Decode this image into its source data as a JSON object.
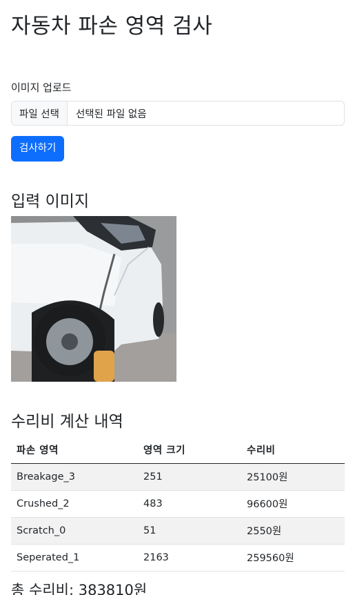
{
  "page": {
    "title": "자동차 파손 영역 검사"
  },
  "upload": {
    "label": "이미지 업로드",
    "file_button": "파일 선택",
    "file_status": "선택된 파일 없음",
    "submit_label": "검사하기"
  },
  "input_section": {
    "title": "입력 이미지"
  },
  "cost_section": {
    "title": "수리비 계산 내역",
    "headers": [
      "파손 영역",
      "영역 크기",
      "수리비"
    ],
    "rows": [
      [
        "Breakage_3",
        "251",
        "25100원"
      ],
      [
        "Crushed_2",
        "483",
        "96600원"
      ],
      [
        "Scratch_0",
        "51",
        "2550원"
      ],
      [
        "Seperated_1",
        "2163",
        "259560원"
      ]
    ],
    "total_label": "총 수리비:",
    "total_value": "383810원"
  },
  "colors": {
    "primary": "#0d6efd",
    "stripe": "#f2f2f2",
    "text": "#212529"
  }
}
